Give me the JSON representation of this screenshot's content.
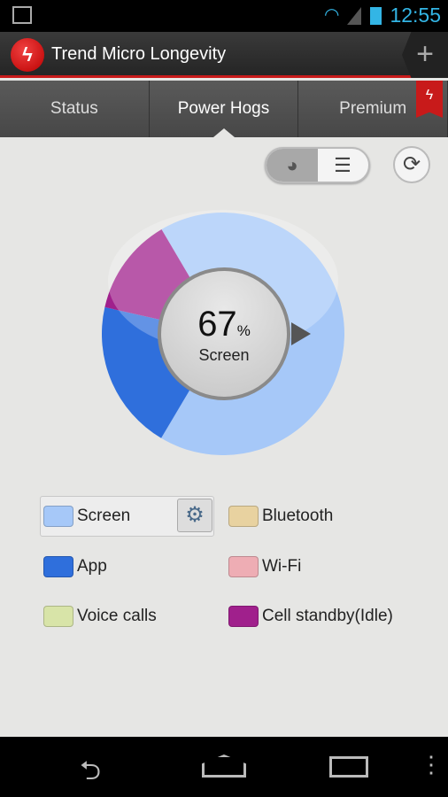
{
  "status_bar": {
    "time": "12:55"
  },
  "app": {
    "title": "Trend Micro Longevity",
    "add_icon": "plus-icon"
  },
  "tabs": [
    {
      "label": "Status"
    },
    {
      "label": "Power Hogs",
      "active": true
    },
    {
      "label": "Premium"
    }
  ],
  "center": {
    "value": "67",
    "unit": "%",
    "label": "Screen"
  },
  "chart_data": {
    "type": "pie",
    "categories": [
      "Screen",
      "App",
      "Cell standby(Idle)"
    ],
    "values": [
      67,
      20,
      13
    ],
    "colors": [
      "#a6c8f8",
      "#2f6fdc",
      "#a0208c"
    ]
  },
  "legend": [
    {
      "label": "Screen",
      "color": "#a6c8f8"
    },
    {
      "label": "Bluetooth",
      "color": "#e8d2a0"
    },
    {
      "label": "App",
      "color": "#2f6fdc"
    },
    {
      "label": "Wi-Fi",
      "color": "#eeadb4"
    },
    {
      "label": "Voice calls",
      "color": "#d8e4a8"
    },
    {
      "label": "Cell standby(Idle)",
      "color": "#a0208c"
    }
  ]
}
